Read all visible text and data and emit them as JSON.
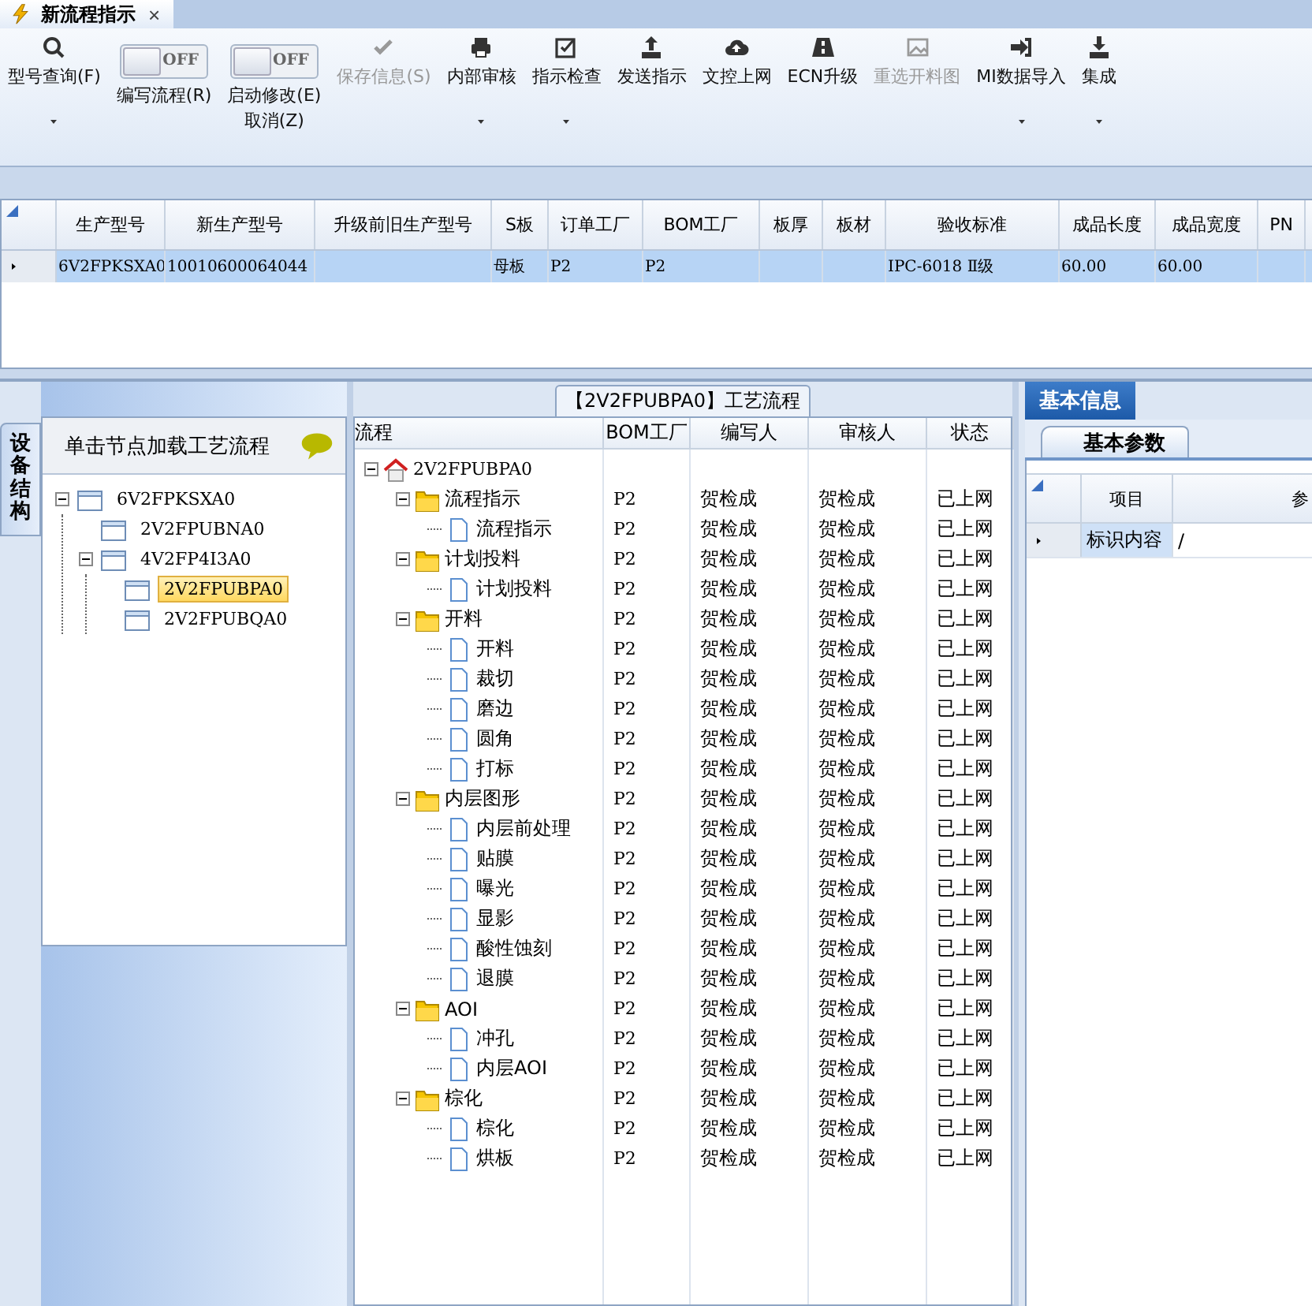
{
  "document_tab": {
    "title": "新流程指示",
    "close": "×"
  },
  "toolbar": [
    {
      "kind": "button",
      "label": "型号查询(F)",
      "disabled": false,
      "dropdown": true
    },
    {
      "kind": "toggle",
      "label": "编写流程(R)",
      "switch_text": "OFF",
      "on": false
    },
    {
      "kind": "toggle",
      "label": "启动修改(E)\n取消(Z)",
      "switch_text": "OFF",
      "on": false
    },
    {
      "kind": "button",
      "label": "保存信息(S)",
      "disabled": true,
      "dropdown": false
    },
    {
      "kind": "button",
      "label": "内部审核",
      "disabled": false,
      "dropdown": true
    },
    {
      "kind": "button",
      "label": "指示检查",
      "disabled": false,
      "dropdown": true
    },
    {
      "kind": "button",
      "label": "发送指示",
      "disabled": false,
      "dropdown": false
    },
    {
      "kind": "button",
      "label": "文控上网",
      "disabled": false,
      "dropdown": false
    },
    {
      "kind": "button",
      "label": "ECN升级",
      "disabled": false,
      "dropdown": false
    },
    {
      "kind": "button",
      "label": "重选开料图",
      "disabled": true,
      "dropdown": false
    },
    {
      "kind": "button",
      "label": "MI数据导入",
      "disabled": false,
      "dropdown": true
    },
    {
      "kind": "button",
      "label": "集成",
      "disabled": false,
      "dropdown": true
    }
  ],
  "product_table": {
    "columns": [
      "生产型号",
      "新生产型号",
      "升级前旧生产型号",
      "S板",
      "订单工厂",
      "BOM工厂",
      "板厚",
      "板材",
      "验收标准",
      "成品长度",
      "成品宽度",
      "PN"
    ],
    "rows": [
      {
        "selected": true,
        "cells": [
          "6V2FPKSXA0",
          "10010600064044",
          "",
          "母板",
          "P2",
          "P2",
          "",
          "",
          "IPC-6018 Ⅱ级",
          "60.00",
          "60.00",
          ""
        ]
      }
    ]
  },
  "side_tab": {
    "label": "设备结构"
  },
  "structure_panel": {
    "hint": "单击节点加载工艺流程",
    "tree": [
      {
        "label": "6V2FPKSXA0",
        "selected": false,
        "expanded": true,
        "children": [
          {
            "label": "2V2FPUBNA0",
            "selected": false
          },
          {
            "label": "4V2FP4I3A0",
            "selected": false,
            "expanded": true,
            "children": [
              {
                "label": "2V2FPUBPA0",
                "selected": true
              },
              {
                "label": "2V2FPUBQA0",
                "selected": false
              }
            ]
          }
        ]
      }
    ]
  },
  "process_panel": {
    "title": "【2V2FPUBPA0】工艺流程",
    "columns": [
      "流程",
      "BOM工厂",
      "编写人",
      "审核人",
      "状态"
    ],
    "tree": [
      {
        "kind": "root",
        "label": "2V2FPUBPA0",
        "expanded": true,
        "children": [
          {
            "kind": "folder",
            "label": "流程指示",
            "bom": "P2",
            "author": "贺检成",
            "reviewer": "贺检成",
            "status": "已上网",
            "expanded": true,
            "children": [
              {
                "kind": "doc",
                "label": "流程指示",
                "bom": "P2",
                "author": "贺检成",
                "reviewer": "贺检成",
                "status": "已上网"
              }
            ]
          },
          {
            "kind": "folder",
            "label": "计划投料",
            "bom": "P2",
            "author": "贺检成",
            "reviewer": "贺检成",
            "status": "已上网",
            "expanded": true,
            "children": [
              {
                "kind": "doc",
                "label": "计划投料",
                "bom": "P2",
                "author": "贺检成",
                "reviewer": "贺检成",
                "status": "已上网"
              }
            ]
          },
          {
            "kind": "folder",
            "label": "开料",
            "bom": "P2",
            "author": "贺检成",
            "reviewer": "贺检成",
            "status": "已上网",
            "expanded": true,
            "children": [
              {
                "kind": "doc",
                "label": "开料",
                "bom": "P2",
                "author": "贺检成",
                "reviewer": "贺检成",
                "status": "已上网"
              },
              {
                "kind": "doc",
                "label": "裁切",
                "bom": "P2",
                "author": "贺检成",
                "reviewer": "贺检成",
                "status": "已上网"
              },
              {
                "kind": "doc",
                "label": "磨边",
                "bom": "P2",
                "author": "贺检成",
                "reviewer": "贺检成",
                "status": "已上网"
              },
              {
                "kind": "doc",
                "label": "圆角",
                "bom": "P2",
                "author": "贺检成",
                "reviewer": "贺检成",
                "status": "已上网"
              },
              {
                "kind": "doc",
                "label": "打标",
                "bom": "P2",
                "author": "贺检成",
                "reviewer": "贺检成",
                "status": "已上网"
              }
            ]
          },
          {
            "kind": "folder",
            "label": "内层图形",
            "bom": "P2",
            "author": "贺检成",
            "reviewer": "贺检成",
            "status": "已上网",
            "expanded": true,
            "children": [
              {
                "kind": "doc",
                "label": "内层前处理",
                "bom": "P2",
                "author": "贺检成",
                "reviewer": "贺检成",
                "status": "已上网"
              },
              {
                "kind": "doc",
                "label": "贴膜",
                "bom": "P2",
                "author": "贺检成",
                "reviewer": "贺检成",
                "status": "已上网"
              },
              {
                "kind": "doc",
                "label": "曝光",
                "bom": "P2",
                "author": "贺检成",
                "reviewer": "贺检成",
                "status": "已上网"
              },
              {
                "kind": "doc",
                "label": "显影",
                "bom": "P2",
                "author": "贺检成",
                "reviewer": "贺检成",
                "status": "已上网"
              },
              {
                "kind": "doc",
                "label": "酸性蚀刻",
                "bom": "P2",
                "author": "贺检成",
                "reviewer": "贺检成",
                "status": "已上网"
              },
              {
                "kind": "doc",
                "label": "退膜",
                "bom": "P2",
                "author": "贺检成",
                "reviewer": "贺检成",
                "status": "已上网"
              }
            ]
          },
          {
            "kind": "folder",
            "label": "AOI",
            "bom": "P2",
            "author": "贺检成",
            "reviewer": "贺检成",
            "status": "已上网",
            "expanded": true,
            "children": [
              {
                "kind": "doc",
                "label": "冲孔",
                "bom": "P2",
                "author": "贺检成",
                "reviewer": "贺检成",
                "status": "已上网"
              },
              {
                "kind": "doc",
                "label": "内层AOI",
                "bom": "P2",
                "author": "贺检成",
                "reviewer": "贺检成",
                "status": "已上网"
              }
            ]
          },
          {
            "kind": "folder",
            "label": "棕化",
            "bom": "P2",
            "author": "贺检成",
            "reviewer": "贺检成",
            "status": "已上网",
            "expanded": true,
            "children": [
              {
                "kind": "doc",
                "label": "棕化",
                "bom": "P2",
                "author": "贺检成",
                "reviewer": "贺检成",
                "status": "已上网"
              },
              {
                "kind": "doc",
                "label": "烘板",
                "bom": "P2",
                "author": "贺检成",
                "reviewer": "贺检成",
                "status": "已上网"
              }
            ]
          }
        ]
      }
    ]
  },
  "info_panel": {
    "title": "基本信息",
    "tabs": [
      {
        "label": "基本参数",
        "selected": true
      }
    ],
    "columns": [
      "项目",
      "参"
    ],
    "rows": [
      {
        "item": "标识内容",
        "value": "/"
      }
    ]
  }
}
